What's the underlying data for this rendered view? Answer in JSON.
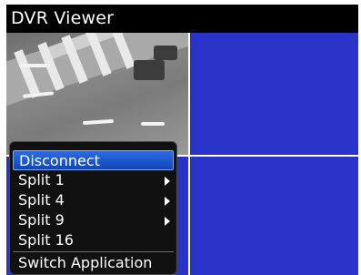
{
  "app": {
    "title": "DVR Viewer"
  },
  "menu": {
    "items": [
      {
        "label": "Disconnect",
        "selected": true,
        "has_submenu": false
      },
      {
        "label": "Split 1",
        "selected": false,
        "has_submenu": true
      },
      {
        "label": "Split 4",
        "selected": false,
        "has_submenu": true
      },
      {
        "label": "Split 9",
        "selected": false,
        "has_submenu": true
      },
      {
        "label": "Split 16",
        "selected": false,
        "has_submenu": false
      }
    ],
    "footer_item": {
      "label": "Switch Application"
    }
  },
  "colors": {
    "empty_channel": "#2a33c8",
    "highlight": "#1c57cf"
  }
}
